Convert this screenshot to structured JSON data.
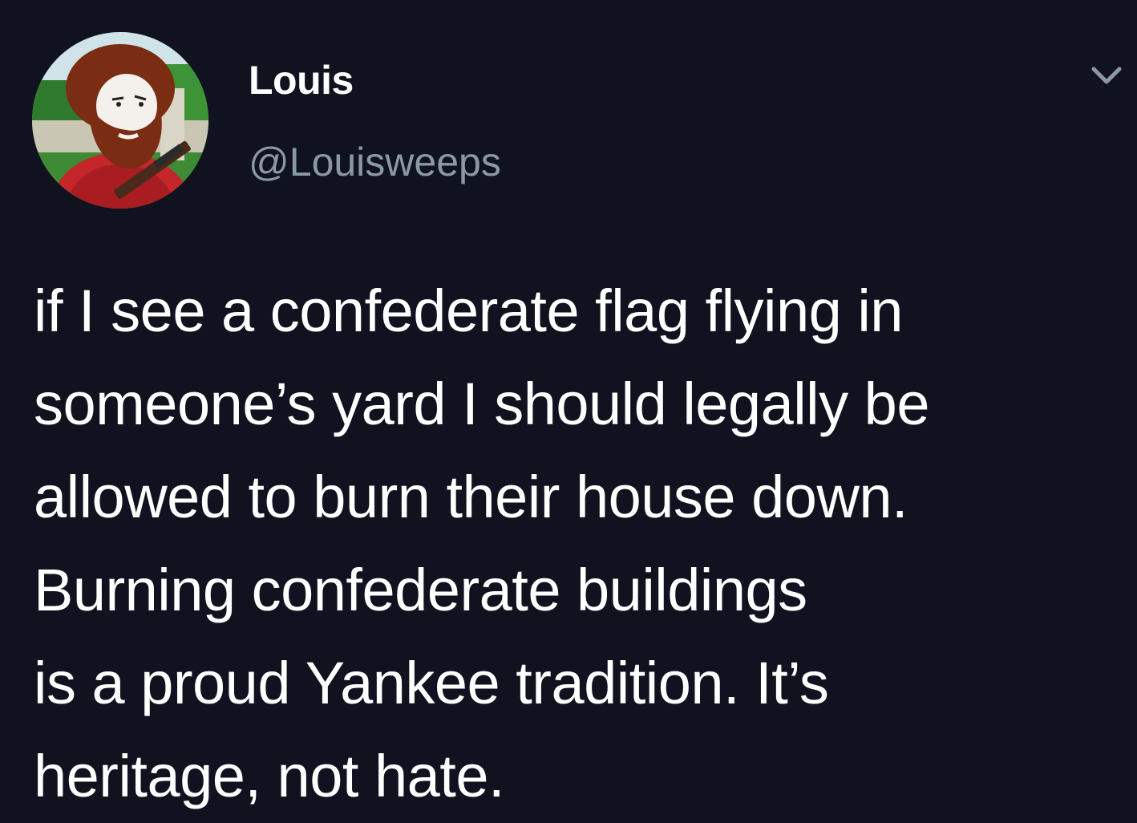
{
  "tweet": {
    "author": {
      "display_name": "Louis",
      "handle": "@Louisweeps",
      "avatar_icon": "bearded-man-avatar"
    },
    "menu_icon": "chevron-down-icon",
    "text_lines": [
      "if I see a confederate flag flying in",
      "someone’s yard I should legally be",
      "allowed to burn their house down.",
      "Burning confederate buildings",
      "is a proud Yankee tradition. It’s",
      "heritage, not hate."
    ]
  },
  "colors": {
    "background": "#10121f",
    "text": "#ffffff",
    "handle": "#8b98a5",
    "chevron": "#8b98a5"
  }
}
